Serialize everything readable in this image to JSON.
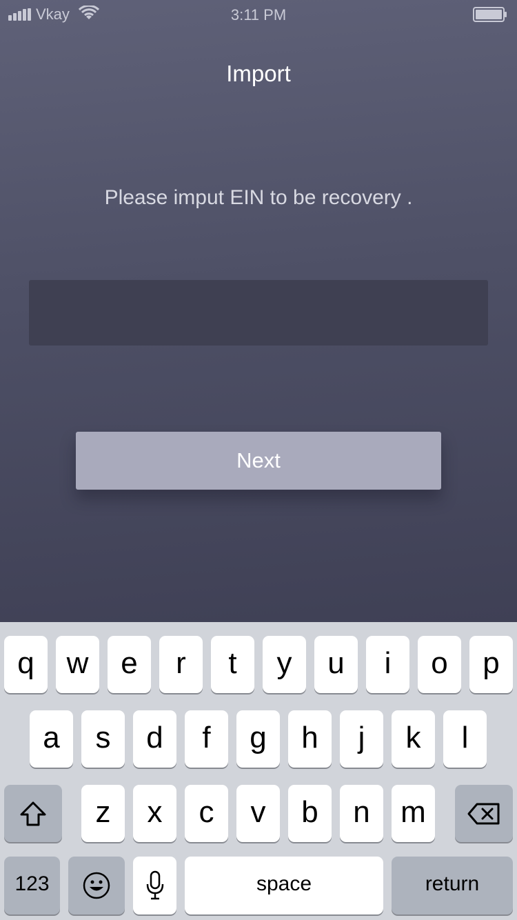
{
  "status_bar": {
    "carrier": "Vkay",
    "time": "3:11 PM",
    "icons": [
      "signal-icon",
      "wifi-icon",
      "battery-icon"
    ]
  },
  "header": {
    "title": "Import"
  },
  "main": {
    "prompt": "Please imput EIN to be recovery .",
    "ein_input": {
      "value": "",
      "placeholder": ""
    },
    "next_label": "Next"
  },
  "keyboard": {
    "row1": [
      "q",
      "w",
      "e",
      "r",
      "t",
      "y",
      "u",
      "i",
      "o",
      "p"
    ],
    "row2": [
      "a",
      "s",
      "d",
      "f",
      "g",
      "h",
      "j",
      "k",
      "l"
    ],
    "row3": [
      "z",
      "x",
      "c",
      "v",
      "b",
      "n",
      "m"
    ],
    "shift_icon": "shift-icon",
    "backspace_icon": "backspace-icon",
    "numbers_label": "123",
    "emoji_icon": "emoji-icon",
    "mic_icon": "microphone-icon",
    "space_label": "space",
    "return_label": "return"
  },
  "colors": {
    "background_top": "#5f6178",
    "background_bottom": "#3f4055",
    "input_bg": "#3f4052",
    "button_bg": "#a9aabc",
    "keyboard_bg": "#d1d4da"
  }
}
